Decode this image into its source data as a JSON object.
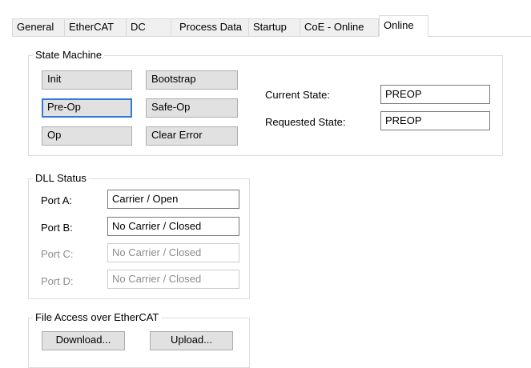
{
  "tabs": [
    {
      "label": "General"
    },
    {
      "label": "EtherCAT"
    },
    {
      "label": "DC"
    },
    {
      "label": "Process Data"
    },
    {
      "label": "Startup"
    },
    {
      "label": "CoE - Online"
    },
    {
      "label": "Online"
    }
  ],
  "active_tab": "Online",
  "state_machine": {
    "title": "State Machine",
    "init_label": "Init",
    "bootstrap_label": "Bootstrap",
    "preop_label": "Pre-Op",
    "safeop_label": "Safe-Op",
    "op_label": "Op",
    "clear_error_label": "Clear Error",
    "current_state_label": "Current State:",
    "current_state_value": "PREOP",
    "requested_state_label": "Requested State:",
    "requested_state_value": "PREOP"
  },
  "dll_status": {
    "title": "DLL Status",
    "ports": [
      {
        "label": "Port A:",
        "value": "Carrier / Open"
      },
      {
        "label": "Port B:",
        "value": "No Carrier / Closed"
      },
      {
        "label": "Port C:",
        "value": "No Carrier / Closed"
      },
      {
        "label": "Port D:",
        "value": "No Carrier / Closed"
      }
    ]
  },
  "file_access": {
    "title": "File Access over EtherCAT",
    "download_label": "Download...",
    "upload_label": "Upload..."
  },
  "colors": {
    "focus_border": "#2f7bd6",
    "button_face": "#e1e1e1",
    "disabled_text": "#8c8c8c"
  }
}
